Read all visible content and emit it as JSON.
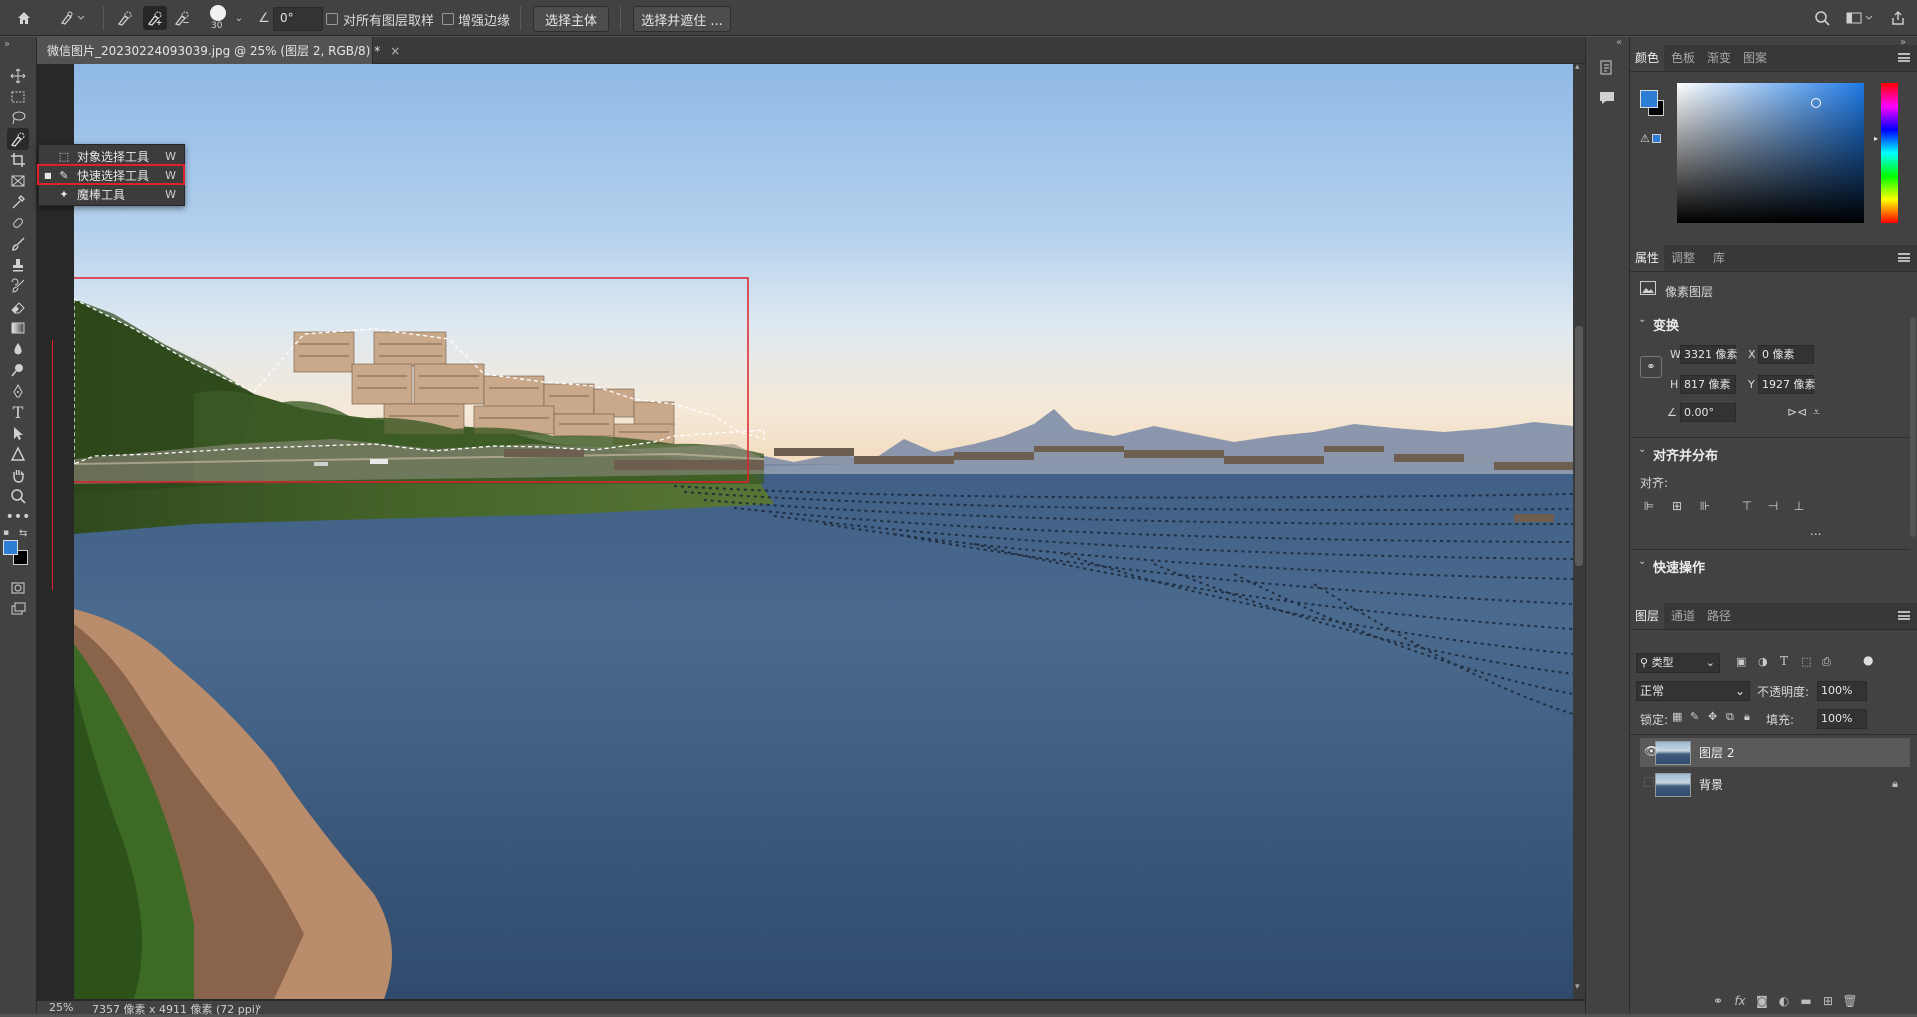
{
  "options_bar": {
    "brush_size": "30",
    "angle_value": "0°",
    "sample_all_layers_label": "对所有图层取样",
    "enhance_edge_label": "增强边缘",
    "select_subject_label": "选择主体",
    "select_and_mask_label": "选择并遮住 ..."
  },
  "document_tab": {
    "title": "微信图片_20230224093039.jpg @ 25% (图层 2, RGB/8) *",
    "close": "×"
  },
  "tool_flyout": {
    "items": [
      {
        "label": "对象选择工具",
        "shortcut": "W",
        "icon": "object-selection-icon"
      },
      {
        "label": "快速选择工具",
        "shortcut": "W",
        "icon": "quick-selection-icon",
        "active": true
      },
      {
        "label": "魔棒工具",
        "shortcut": "W",
        "icon": "magic-wand-icon"
      }
    ]
  },
  "status_bar": {
    "zoom": "25%",
    "doc_info": "7357 像素 x 4911 像素 (72 ppi)",
    "arrow": "›"
  },
  "color_panel": {
    "tabs": [
      "颜色",
      "色板",
      "渐变",
      "图案"
    ],
    "foreground": "#2d7fd6",
    "background": "#000000"
  },
  "properties_panel": {
    "tabs": [
      "属性",
      "调整",
      "库"
    ],
    "layer_type": "像素图层",
    "transform_title": "变换",
    "w_label": "W",
    "w_value": "3321 像素",
    "x_label": "X",
    "x_value": "0 像素",
    "h_label": "H",
    "h_value": "817 像素",
    "y_label": "Y",
    "y_value": "1927 像素",
    "angle_value": "0.00°",
    "align_title": "对齐并分布",
    "align_label": "对齐:",
    "more": "...",
    "quick_actions_title": "快速操作"
  },
  "layers_panel": {
    "tabs": [
      "图层",
      "通道",
      "路径"
    ],
    "filter_kind": "类型",
    "blend_mode": "正常",
    "opacity_label": "不透明度:",
    "opacity_value": "100%",
    "lock_label": "锁定:",
    "fill_label": "填充:",
    "fill_value": "100%",
    "layers": [
      {
        "name": "图层 2",
        "visible": true,
        "selected": true
      },
      {
        "name": "背景",
        "visible": false,
        "locked": true
      }
    ]
  }
}
